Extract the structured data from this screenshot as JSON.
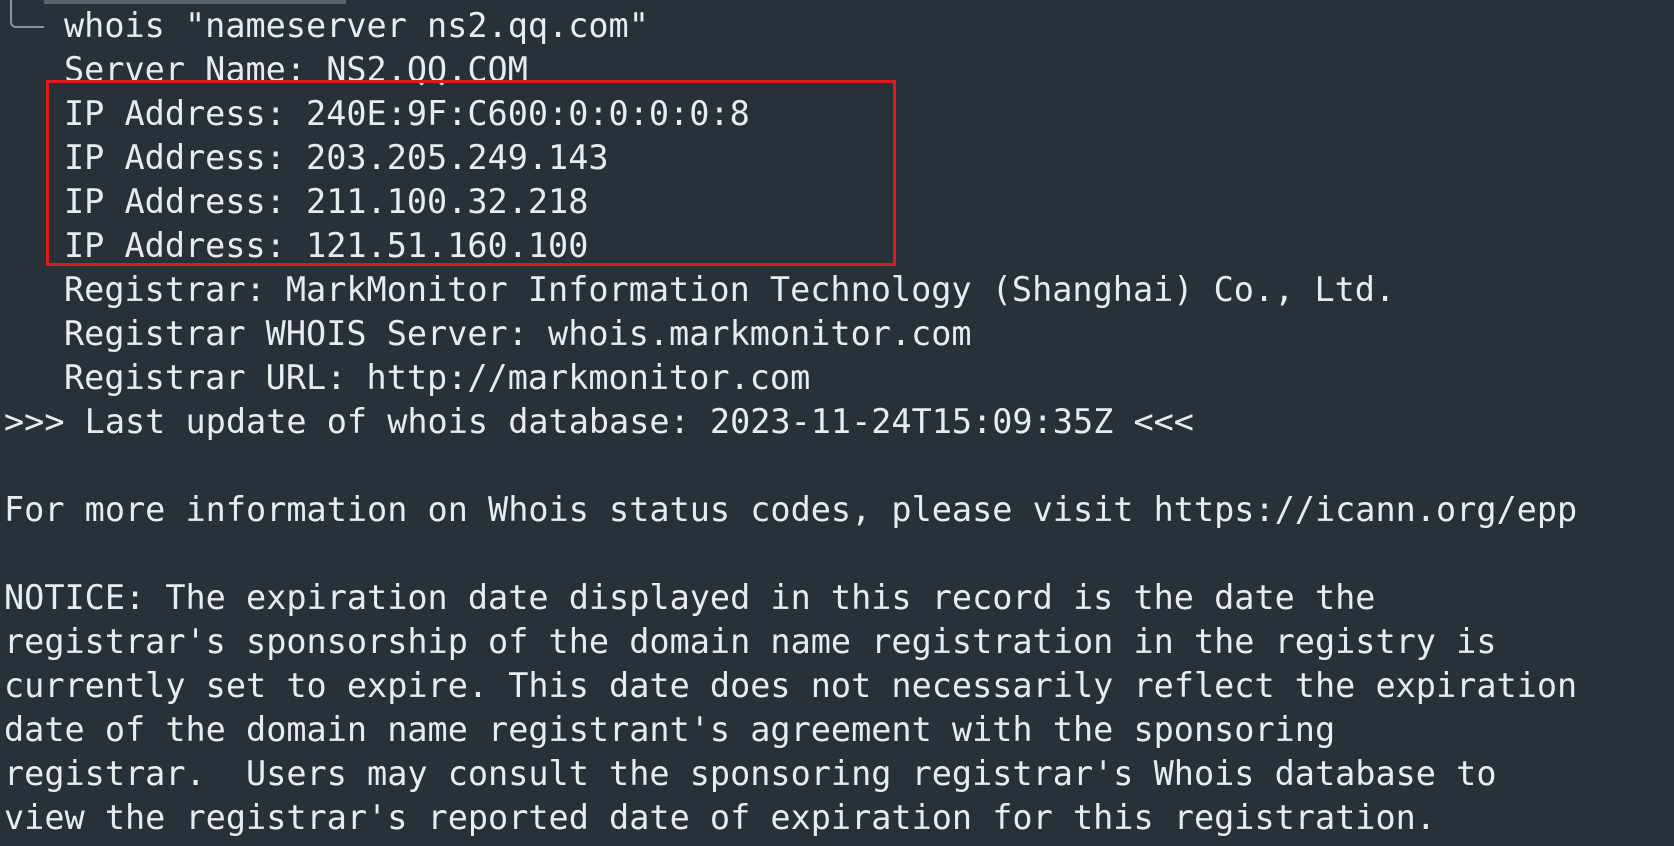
{
  "terminal": {
    "command": "whois \"nameserver ns2.qq.com\"",
    "server_name": "Server Name: NS2.QQ.COM",
    "ip_addresses": [
      "IP Address: 240E:9F:C600:0:0:0:0:8",
      "IP Address: 203.205.249.143",
      "IP Address: 211.100.32.218",
      "IP Address: 121.51.160.100"
    ],
    "registrar": "Registrar: MarkMonitor Information Technology (Shanghai) Co., Ltd.",
    "registrar_whois_server": "Registrar WHOIS Server: whois.markmonitor.com",
    "registrar_url": "Registrar URL: http://markmonitor.com",
    "last_update": ">>> Last update of whois database: 2023-11-24T15:09:35Z <<<",
    "status_info": "For more information on Whois status codes, please visit https://icann.org/epp",
    "notice_lines": [
      "NOTICE: The expiration date displayed in this record is the date the",
      "registrar's sponsorship of the domain name registration in the registry is",
      "currently set to expire. This date does not necessarily reflect the expiration",
      "date of the domain name registrant's agreement with the sponsoring",
      "registrar.  Users may consult the sponsoring registrar's Whois database to",
      "view the registrar's reported date of expiration for this registration."
    ]
  },
  "colors": {
    "background": "#28313a",
    "foreground": "#e9ecef",
    "highlight": "#e01919"
  }
}
